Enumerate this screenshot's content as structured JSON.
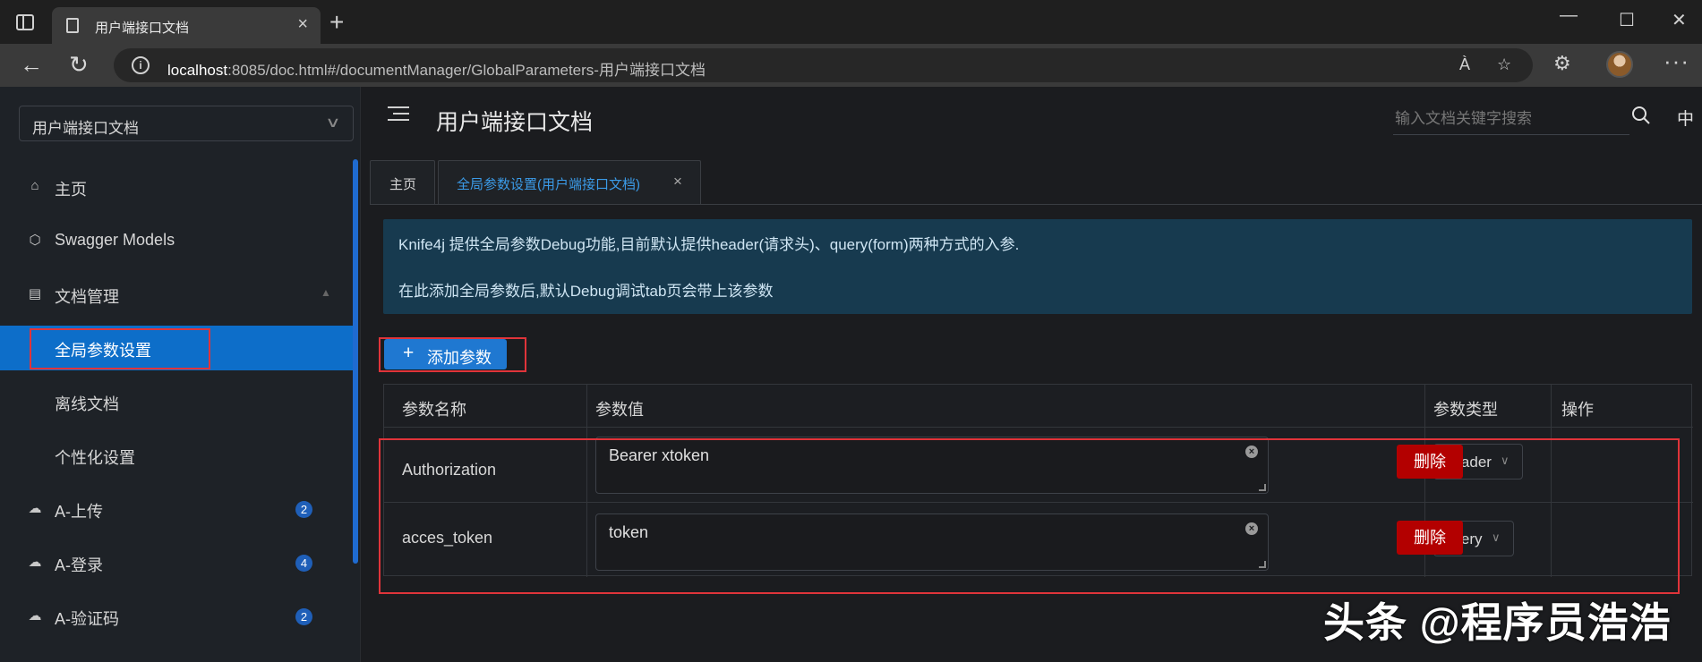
{
  "browser": {
    "tab_title": "用户端接口文档",
    "url_prefix": "localhost",
    "url_rest": ":8085/doc.html#/documentManager/GlobalParameters-用户端接口文档",
    "read_aloud_icon": "À",
    "icons": [
      "sidebar-toggle-icon",
      "document-icon",
      "close-icon",
      "plus-icon",
      "minimize-icon",
      "maximize-icon",
      "close-icon",
      "back-icon",
      "refresh-icon",
      "info-icon",
      "read-aloud-icon",
      "favorite-add-icon",
      "extensions-icon",
      "avatar",
      "more-icon"
    ]
  },
  "sidebar": {
    "group_select": "用户端接口文档",
    "items": [
      {
        "label": "主页",
        "icon": "home-icon"
      },
      {
        "label": "Swagger Models",
        "icon": "cube-icon"
      },
      {
        "label": "文档管理",
        "icon": "doc-manage-icon"
      },
      {
        "label": "全局参数设置",
        "active": true
      },
      {
        "label": "离线文档"
      },
      {
        "label": "个性化设置"
      },
      {
        "label": "A-上传",
        "icon": "cloud-icon",
        "badge": "2"
      },
      {
        "label": "A-登录",
        "icon": "cloud-icon",
        "badge": "4"
      },
      {
        "label": "A-验证码",
        "icon": "cloud-icon",
        "badge": "2"
      }
    ]
  },
  "header": {
    "title": "用户端接口文档",
    "search_placeholder": "输入文档关键字搜索",
    "lang": "中"
  },
  "tabs": [
    {
      "label": "主页"
    },
    {
      "label": "全局参数设置(用户端接口文档)",
      "close": "×"
    }
  ],
  "notice": {
    "line1": "Knife4j 提供全局参数Debug功能,目前默认提供header(请求头)、query(form)两种方式的入参.",
    "line2": "在此添加全局参数后,默认Debug调试tab页会带上该参数"
  },
  "add_button": {
    "label": "添加参数"
  },
  "table": {
    "headers": [
      "参数名称",
      "参数值",
      "参数类型",
      "操作"
    ],
    "rows": [
      {
        "name": "Authorization",
        "value": "Bearer xtoken",
        "type": "header",
        "action": "删除"
      },
      {
        "name": "acces_token",
        "value": "token",
        "type": "query",
        "action": "删除"
      }
    ]
  },
  "watermark": "头条 @程序员浩浩",
  "colors": {
    "accent": "#1f78d1",
    "active_menu": "#0d6ec9",
    "danger": "#b30000",
    "highlight_box": "#e0343a",
    "notice_bg": "#173a4f"
  }
}
